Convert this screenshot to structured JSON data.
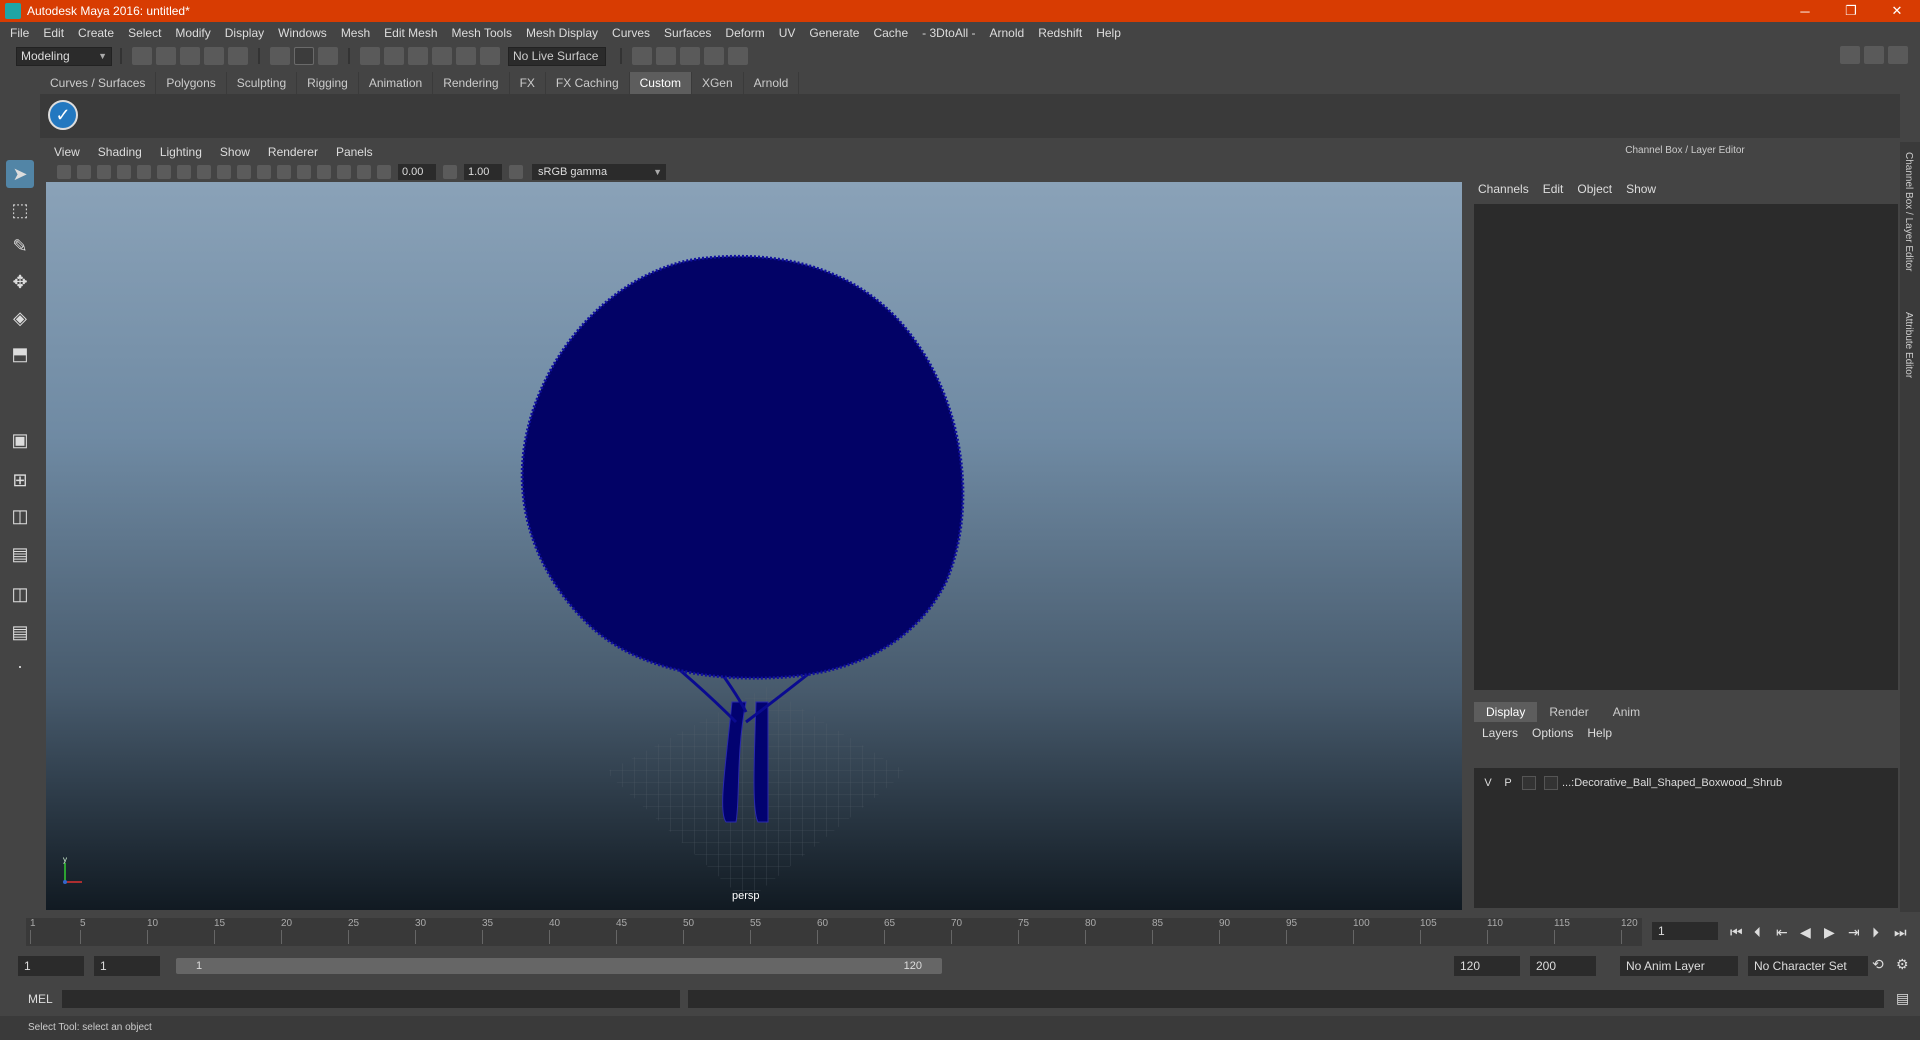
{
  "window": {
    "title": "Autodesk Maya 2016: untitled*",
    "minimize": "─",
    "maximize": "❐",
    "close": "✕"
  },
  "menubar": [
    "File",
    "Edit",
    "Create",
    "Select",
    "Modify",
    "Display",
    "Windows",
    "Mesh",
    "Edit Mesh",
    "Mesh Tools",
    "Mesh Display",
    "Curves",
    "Surfaces",
    "Deform",
    "UV",
    "Generate",
    "Cache",
    "- 3DtoAll -",
    "Arnold",
    "Redshift",
    "Help"
  ],
  "statusline": {
    "mode": "Modeling",
    "live_surface": "No Live Surface"
  },
  "shelf": {
    "tabs": [
      "Curves / Surfaces",
      "Polygons",
      "Sculpting",
      "Rigging",
      "Animation",
      "Rendering",
      "FX",
      "FX Caching",
      "Custom",
      "XGen",
      "Arnold"
    ],
    "active": "Custom"
  },
  "viewport": {
    "menu": [
      "View",
      "Shading",
      "Lighting",
      "Show",
      "Renderer",
      "Panels"
    ],
    "exposure": "0.00",
    "gamma_value": "1.00",
    "color_space": "sRGB gamma",
    "camera": "persp",
    "axis_y": "y"
  },
  "channelbox": {
    "title": "Channel Box / Layer Editor",
    "menu": [
      "Channels",
      "Edit",
      "Object",
      "Show"
    ]
  },
  "layers": {
    "tabs": [
      "Display",
      "Render",
      "Anim"
    ],
    "active": "Display",
    "menu": [
      "Layers",
      "Options",
      "Help"
    ],
    "rows": [
      {
        "v": "V",
        "p": "P",
        "name": "...:Decorative_Ball_Shaped_Boxwood_Shrub"
      }
    ]
  },
  "side_tabs": [
    "Channel Box / Layer Editor",
    "Attribute Editor"
  ],
  "timeline": {
    "ticks": [
      "1",
      "5",
      "10",
      "15",
      "20",
      "25",
      "30",
      "35",
      "40",
      "45",
      "50",
      "55",
      "60",
      "65",
      "70",
      "75",
      "80",
      "85",
      "90",
      "95",
      "100",
      "105",
      "110",
      "115",
      "120"
    ],
    "current_frame": "1"
  },
  "range": {
    "start": "1",
    "playback_start": "1",
    "slider_start": "1",
    "slider_end": "120",
    "playback_end": "120",
    "end": "200",
    "anim_layer": "No Anim Layer",
    "char_set": "No Character Set"
  },
  "command": {
    "label": "MEL"
  },
  "help_line": "Select Tool: select an object"
}
